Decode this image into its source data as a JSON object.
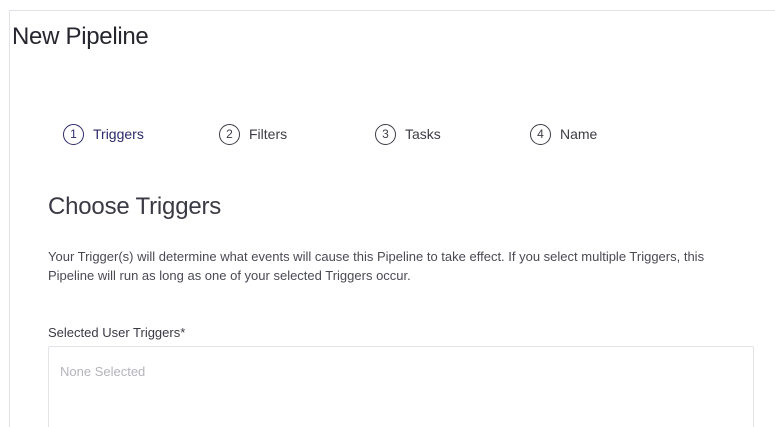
{
  "page": {
    "title": "New Pipeline"
  },
  "stepper": {
    "steps": [
      {
        "number": "1",
        "label": "Triggers",
        "active": true
      },
      {
        "number": "2",
        "label": "Filters",
        "active": false
      },
      {
        "number": "3",
        "label": "Tasks",
        "active": false
      },
      {
        "number": "4",
        "label": "Name",
        "active": false
      }
    ]
  },
  "section": {
    "title": "Choose Triggers",
    "description": "Your Trigger(s) will determine what events will cause this Pipeline to take effect. If you select multiple Triggers, this Pipeline will run as long as one of your selected Triggers occur."
  },
  "triggers_field": {
    "label": "Selected User Triggers*",
    "placeholder": "None Selected"
  },
  "colors": {
    "active_step": "#2c2a6b",
    "text": "#3a3a44",
    "border": "#e3e3e8",
    "placeholder": "#b4b4bb"
  }
}
